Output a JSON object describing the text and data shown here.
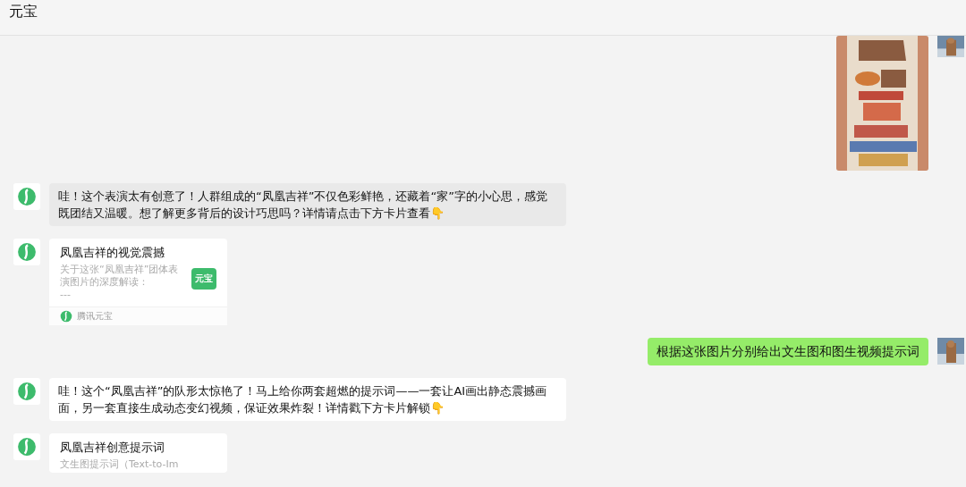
{
  "window": {
    "title": "元宝"
  },
  "messages": [
    {
      "kind": "user-image"
    },
    {
      "kind": "bot-text",
      "highlighted": true,
      "text": "哇！这个表演太有创意了！人群组成的“凤凰吉祥”不仅色彩鲜艳，还藏着“家”字的小心思，感觉既团结又温暖。想了解更多背后的设计巧思吗？详情请点击下方卡片查看👇"
    },
    {
      "kind": "bot-card",
      "title": "凤凰吉祥的视觉震撼",
      "description": "关于这张“凤凰吉祥”团体表演图片的深度解读：",
      "extra": "---",
      "badge": "元宝",
      "source": "腾讯元宝"
    },
    {
      "kind": "user-text",
      "text": "根据这张图片分别给出文生图和图生视频提示词"
    },
    {
      "kind": "bot-text",
      "highlighted": false,
      "text": "哇！这个“凤凰吉祥”的队形太惊艳了！马上给你两套超燃的提示词——一套让AI画出静态震撼画面，另一套直接生成动态变幻视频，保证效果炸裂！详情戳下方卡片解锁👇"
    },
    {
      "kind": "bot-card",
      "title": "凤凰吉祥创意提示词",
      "description": "文生图提示词（Text-to-Im"
    }
  ]
}
